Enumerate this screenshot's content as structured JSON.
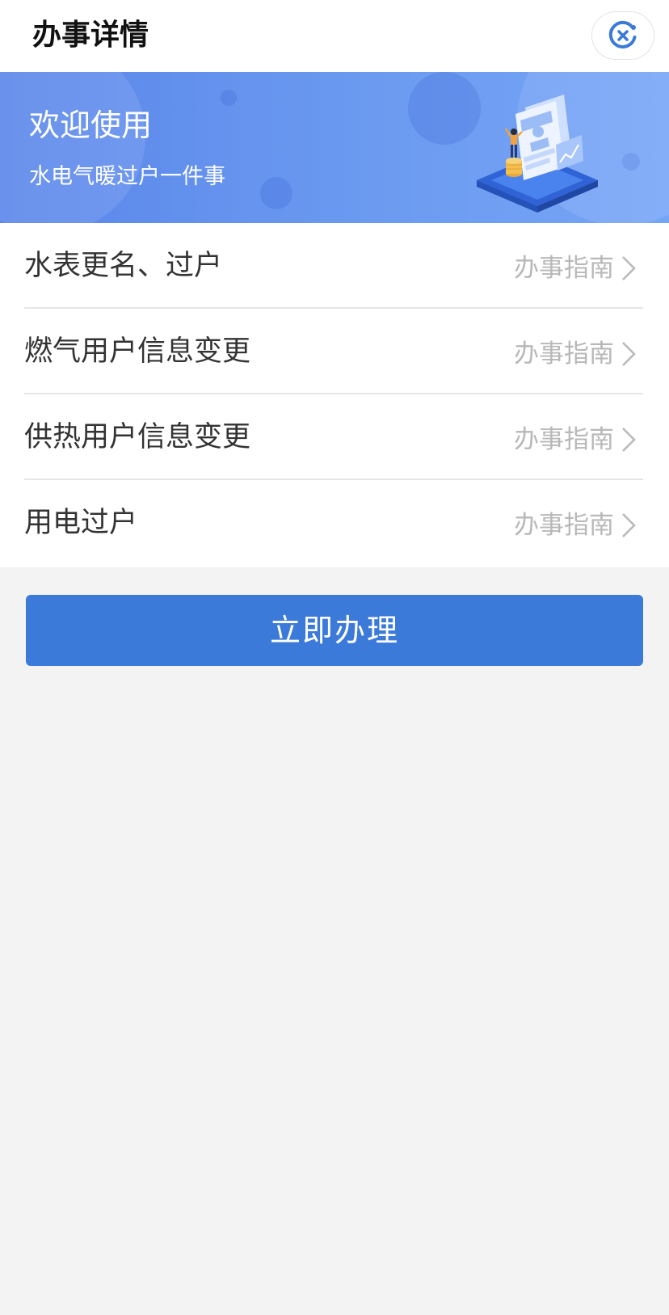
{
  "header": {
    "title": "办事详情",
    "close_icon": "close-circle-icon"
  },
  "banner": {
    "title": "欢迎使用",
    "subtitle": "水电气暖过户一件事",
    "illustration": "document-person-illustration"
  },
  "items": [
    {
      "label": "水表更名、过户",
      "guide": "办事指南"
    },
    {
      "label": "燃气用户信息变更",
      "guide": "办事指南"
    },
    {
      "label": "供热用户信息变更",
      "guide": "办事指南"
    },
    {
      "label": "用电过户",
      "guide": "办事指南"
    }
  ],
  "action": {
    "label": "立即办理"
  },
  "colors": {
    "primary": "#3b7ad9",
    "banner_gradient_start": "#5a86ea",
    "banner_gradient_end": "#76a5f6",
    "guide_text": "#b8b8b8",
    "background": "#f3f3f3"
  }
}
